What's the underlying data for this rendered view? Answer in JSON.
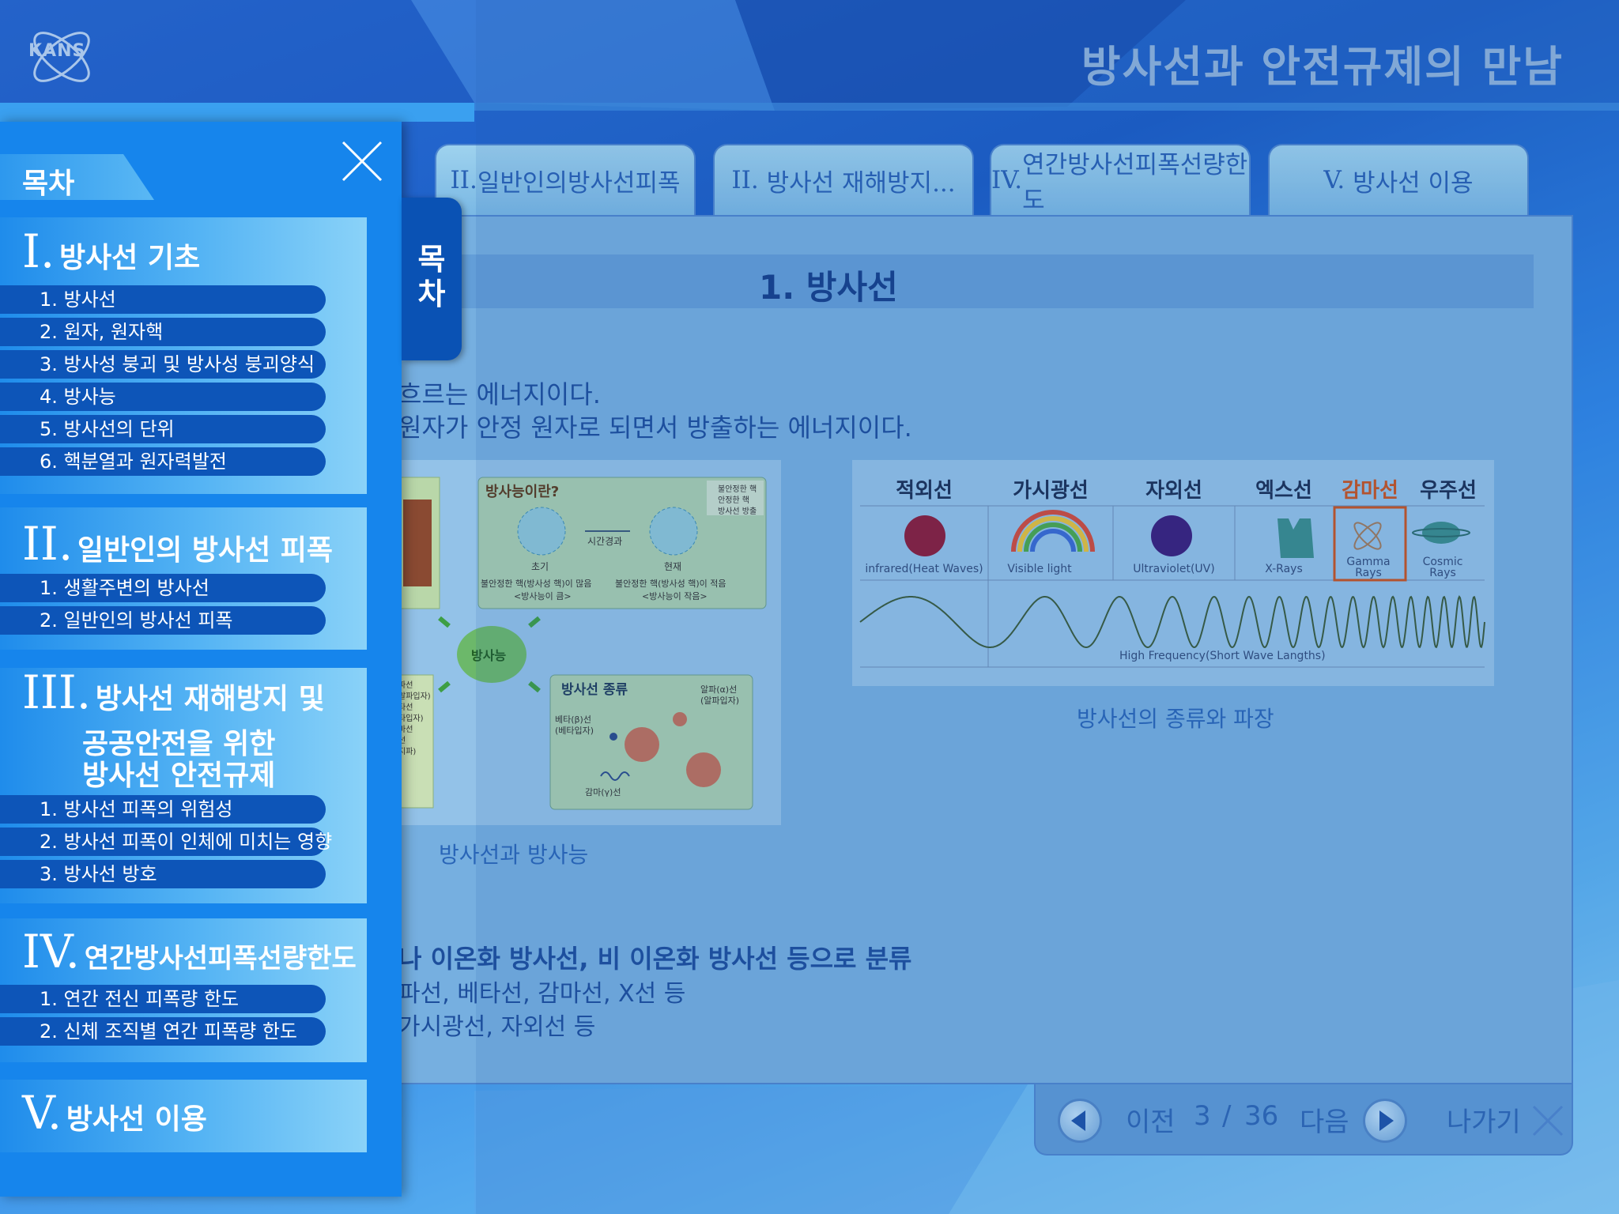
{
  "header": {
    "title": "방사선과 안전규제의 만남",
    "logo": "KANS"
  },
  "tabs": [
    {
      "numeral": "II.",
      "label": "일반인의방사선피폭"
    },
    {
      "numeral": "II.",
      "label": "방사선 재해방지..."
    },
    {
      "numeral": "IV.",
      "label": "연간방사선피폭선량한도"
    },
    {
      "numeral": "V.",
      "label": "방사선 이용"
    }
  ],
  "content": {
    "section_title": "1. 방사선",
    "line1": "흐르는 에너지이다.",
    "line2": "원자가 안정 원자로 되면서 방출하는 에너지이다.",
    "line3": "나 이온화 방사선, 비 이온화 방사선 등으로 분류",
    "line4": "파선, 베타선, 감마선, X선 등",
    "line5": "가시광선, 자외선 등",
    "caption_left": "방사선과 방사능",
    "caption_right": "방사선의 종류와 파장"
  },
  "radioactivity_figure": {
    "title": "방사능이란?",
    "legend": [
      "불안정한 핵",
      "안정한 핵",
      "방사선 방출"
    ],
    "time_label": "시간경과",
    "initial": "초기",
    "current": "현재",
    "initial_desc": "불안정한 핵(방사성 핵)이 많음",
    "initial_desc2": "<방사능이 큼>",
    "current_desc": "불안정한 핵(방사성 핵)이 적음",
    "current_desc2": "<방사능이 작음>",
    "center": "방사능",
    "types_title": "방사선 종류",
    "alpha": "알파(α)선",
    "alpha2": "(알파입자)",
    "beta": "베타(β)선",
    "beta2": "(베타입자)",
    "gamma": "감마(γ)선",
    "side": [
      "파선",
      "알파입자)",
      "타선",
      "타입자)",
      "마선",
      "선",
      "지파)"
    ]
  },
  "spectrum": {
    "columns": [
      {
        "name": "적외선",
        "sub": "infrared(Heat Waves)"
      },
      {
        "name": "가시광선",
        "sub": "Visible light"
      },
      {
        "name": "자외선",
        "sub": "Ultraviolet(UV)"
      },
      {
        "name": "엑스선",
        "sub": "X-Rays"
      },
      {
        "name": "감마선",
        "sub": "Gamma Rays"
      },
      {
        "name": "우주선",
        "sub": "Cosmic Rays"
      }
    ],
    "wave_label": "High Frequency(Short Wave Langths)"
  },
  "nav": {
    "prev": "이전",
    "current": "3",
    "sep": "/",
    "total": "36",
    "next": "다음",
    "exit": "나가기"
  },
  "toc": {
    "heading": "목차",
    "tab_label_1": "목",
    "tab_label_2": "차",
    "sections": [
      {
        "numeral": "I.",
        "name": "방사선 기초",
        "items": [
          "1. 방사선",
          "2. 원자, 원자핵",
          "3. 방사성 붕괴 및 방사성 붕괴양식",
          "4. 방사능",
          "5. 방사선의 단위",
          "6. 핵분열과 원자력발전"
        ]
      },
      {
        "numeral": "II.",
        "name": "일반인의 방사선 피폭",
        "items": [
          "1. 생활주변의 방사선",
          "2. 일반인의 방사선 피폭"
        ]
      },
      {
        "numeral": "III.",
        "name": "방사선 재해방지 및",
        "name2": "공공안전을 위한",
        "name3": "방사선 안전규제",
        "items": [
          "1. 방사선 피폭의 위험성",
          "2. 방사선 피폭이 인체에 미치는 영향",
          "3. 방사선 방호"
        ]
      },
      {
        "numeral": "IV.",
        "name": "연간방사선피폭선량한도",
        "items": [
          "1. 연간 전신 피폭량 한도",
          "2. 신체 조직별 연간 피폭량 한도"
        ]
      },
      {
        "numeral": "V.",
        "name": "방사선 이용",
        "items": []
      }
    ]
  },
  "colors": {
    "toc_blue": "#1685ec",
    "item_blue": "#0d55b8",
    "accent_orange": "#c8521e"
  }
}
